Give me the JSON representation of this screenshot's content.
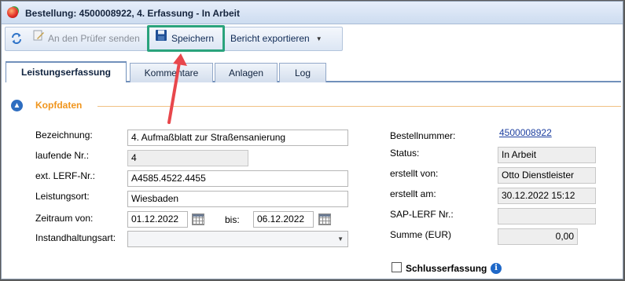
{
  "window": {
    "title": "Bestellung: 4500008922, 4. Erfassung - In Arbeit"
  },
  "toolbar": {
    "send_label": "An den Prüfer senden",
    "save_label": "Speichern",
    "export_label": "Bericht exportieren"
  },
  "tabs": [
    "Leistungserfassung",
    "Kommentare",
    "Anlagen",
    "Log"
  ],
  "section": {
    "title": "Kopfdaten"
  },
  "left_form": {
    "bezeichnung": {
      "label": "Bezeichnung:",
      "value": "4. Aufmaßblatt zur Straßensanierung"
    },
    "laufende_nr": {
      "label": "laufende Nr.:",
      "value": "4"
    },
    "ext_lerf_nr": {
      "label": "ext. LERF-Nr.:",
      "value": "A4585.4522.4455"
    },
    "leistungsort": {
      "label": "Leistungsort:",
      "value": "Wiesbaden"
    },
    "zeitraum": {
      "label": "Zeitraum von:",
      "from": "01.12.2022",
      "to_label": "bis:",
      "to": "06.12.2022"
    },
    "instandhaltungsart": {
      "label": "Instandhaltungsart:",
      "value": ""
    }
  },
  "right_form": {
    "bestellnummer": {
      "label": "Bestellnummer:",
      "value": "4500008922"
    },
    "status": {
      "label": "Status:",
      "value": "In Arbeit"
    },
    "erstellt_von": {
      "label": "erstellt von:",
      "value": "Otto Dienstleister"
    },
    "erstellt_am": {
      "label": "erstellt am:",
      "value": "30.12.2022 15:12"
    },
    "sap_lerf_nr": {
      "label": "SAP-LERF Nr.:",
      "value": ""
    },
    "summe": {
      "label": "Summe (EUR)",
      "value": "0,00"
    }
  },
  "schlusserfassung": {
    "label": "Schlusserfassung",
    "checked": false
  },
  "colors": {
    "highlight": "#2aa37c",
    "annotation_arrow": "#e8474c",
    "section_title": "#f0951d",
    "tab_border": "#7190bb"
  },
  "icons": [
    "app-icon",
    "refresh-icon",
    "send-icon",
    "save-icon",
    "chevron-down-icon",
    "collapse-up-icon",
    "calendar-icon",
    "info-icon",
    "checkbox-icon"
  ]
}
